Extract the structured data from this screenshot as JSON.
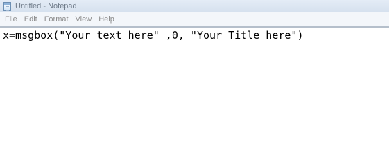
{
  "window": {
    "title": "Untitled - Notepad",
    "icon": "notepad-icon"
  },
  "menu": {
    "items": [
      "File",
      "Edit",
      "Format",
      "View",
      "Help"
    ]
  },
  "editor": {
    "content": "x=msgbox(\"Your text here\" ,0, \"Your Title here\")"
  },
  "colors": {
    "titlebar": "#dbe5f1",
    "menubar": "#f3f6fa",
    "menu_text": "#8c8c8c"
  }
}
